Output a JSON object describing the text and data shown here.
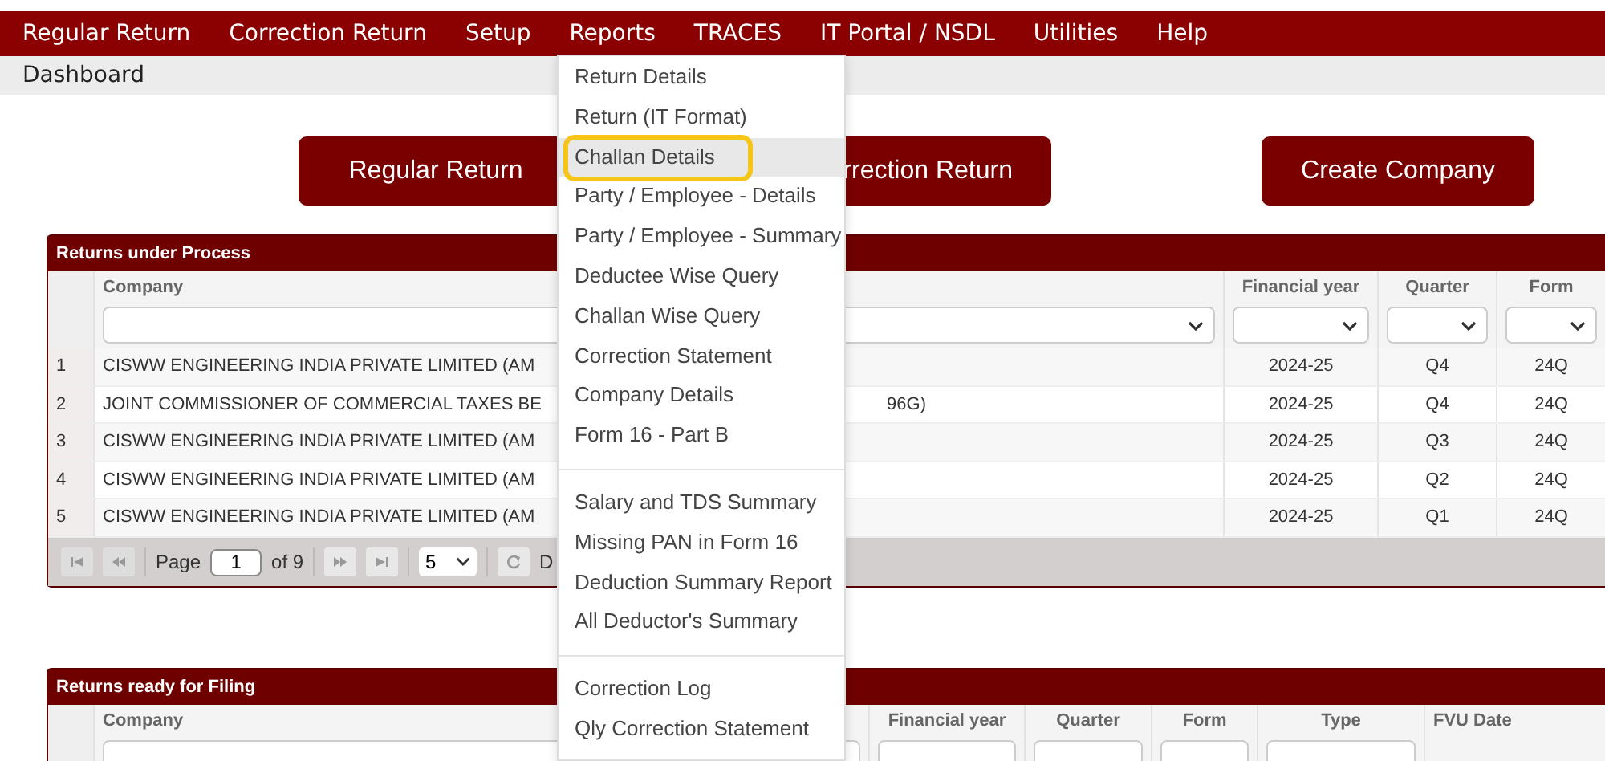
{
  "menubar": {
    "items": [
      "Regular Return",
      "Correction Return",
      "Setup",
      "Reports",
      "TRACES",
      "IT Portal / NSDL",
      "Utilities",
      "Help"
    ]
  },
  "breadcrumb": "Dashboard",
  "actions": [
    {
      "label": "Regular Return"
    },
    {
      "label": "rrection Return"
    },
    {
      "label": "Create Company"
    }
  ],
  "reports_menu": {
    "groups": [
      [
        {
          "label": "Return Details",
          "selected": false,
          "highlighted": false
        },
        {
          "label": "Return (IT Format)",
          "selected": false,
          "highlighted": false
        },
        {
          "label": "Challan Details",
          "selected": true,
          "highlighted": true
        },
        {
          "label": "Party / Employee - Details",
          "selected": false,
          "highlighted": false
        },
        {
          "label": "Party / Employee - Summary",
          "selected": false,
          "highlighted": false
        },
        {
          "label": "Deductee Wise Query",
          "selected": false,
          "highlighted": false
        },
        {
          "label": "Challan Wise Query",
          "selected": false,
          "highlighted": false
        },
        {
          "label": "Correction Statement",
          "selected": false,
          "highlighted": false
        },
        {
          "label": "Company Details",
          "selected": false,
          "highlighted": false
        },
        {
          "label": "Form 16 - Part B",
          "selected": false,
          "highlighted": false
        }
      ],
      [
        {
          "label": "Salary and TDS Summary",
          "selected": false,
          "highlighted": false
        },
        {
          "label": "Missing PAN in Form 16",
          "selected": false,
          "highlighted": false
        },
        {
          "label": "Deduction Summary Report",
          "selected": false,
          "highlighted": false
        },
        {
          "label": "All Deductor's Summary",
          "selected": false,
          "highlighted": false
        }
      ],
      [
        {
          "label": "Correction Log",
          "selected": false,
          "highlighted": false
        },
        {
          "label": "Qly Correction Statement",
          "selected": false,
          "highlighted": false
        }
      ]
    ]
  },
  "returns_under_process": {
    "title": "Returns under Process",
    "columns": [
      "Company",
      "Financial year",
      "Quarter",
      "Form"
    ],
    "rows": [
      {
        "no": "1",
        "company": "CISWW ENGINEERING INDIA PRIVATE LIMITED (AM",
        "year": "2024-25",
        "quarter": "Q4",
        "form": "24Q"
      },
      {
        "no": "2",
        "company": "JOINT COMMISSIONER OF COMMERCIAL TAXES BE",
        "company_tail": "96G)",
        "year": "2024-25",
        "quarter": "Q4",
        "form": "24Q"
      },
      {
        "no": "3",
        "company": "CISWW ENGINEERING INDIA PRIVATE LIMITED (AM",
        "year": "2024-25",
        "quarter": "Q3",
        "form": "24Q"
      },
      {
        "no": "4",
        "company": "CISWW ENGINEERING INDIA PRIVATE LIMITED (AM",
        "year": "2024-25",
        "quarter": "Q2",
        "form": "24Q"
      },
      {
        "no": "5",
        "company": "CISWW ENGINEERING INDIA PRIVATE LIMITED (AM",
        "year": "2024-25",
        "quarter": "Q1",
        "form": "24Q"
      }
    ],
    "pager": {
      "page_label": "Page",
      "page": "1",
      "of_label": "of 9",
      "page_size": "5",
      "trailing": "D"
    }
  },
  "returns_ready": {
    "title": "Returns ready for Filing",
    "columns": [
      "Company",
      "Financial year",
      "Quarter",
      "Form",
      "Type",
      "FVU Date"
    ]
  }
}
